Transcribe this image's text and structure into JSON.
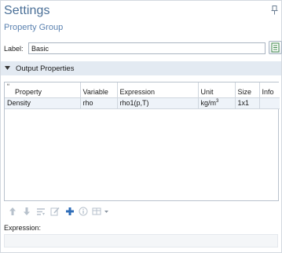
{
  "header": {
    "title": "Settings",
    "subtitle": "Property Group"
  },
  "label_row": {
    "label": "Label:",
    "value": "Basic"
  },
  "section": {
    "title": "Output Properties"
  },
  "table": {
    "columns": [
      "Property",
      "Variable",
      "Expression",
      "Unit",
      "Size",
      "Info"
    ],
    "rows": [
      {
        "property": "Density",
        "variable": "rho",
        "expression": "rho1(p,T)",
        "unit_base": "kg/m",
        "unit_exp": "3",
        "size": "1x1",
        "info": ""
      }
    ]
  },
  "toolbar": {
    "icons": [
      "move-up-icon",
      "move-down-icon",
      "load-list-icon",
      "edit-icon",
      "add-icon",
      "info-icon",
      "table-options-dropdown-icon"
    ]
  },
  "expression": {
    "label": "Expression:",
    "value": ""
  },
  "colors": {
    "title": "#4a6f97",
    "section_bg": "#e3eaf2",
    "selected_row": "#eef3f9",
    "add_icon": "#2f6db8"
  }
}
